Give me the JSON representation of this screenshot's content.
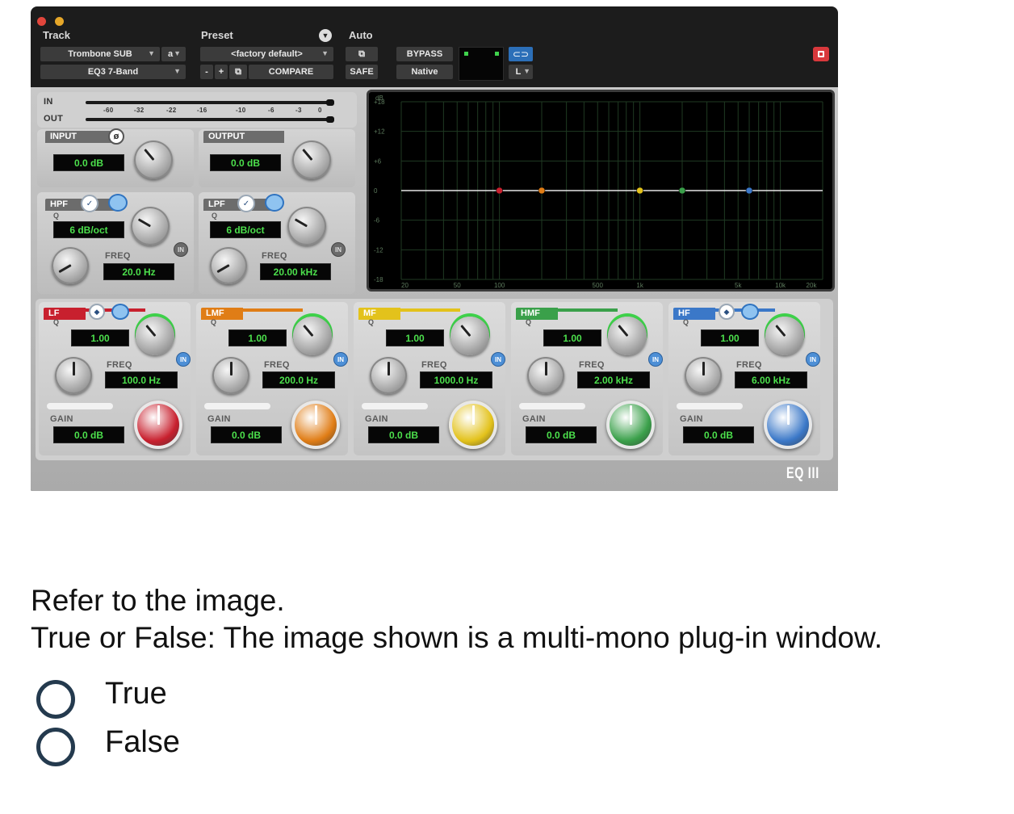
{
  "plugin": {
    "track_header": "Track",
    "preset_header": "Preset",
    "auto_header": "Auto",
    "track_name": "Trombone SUB",
    "track_slot": "a",
    "insert_name": "EQ3 7-Band",
    "preset_name": "<factory default>",
    "compare_label": "COMPARE",
    "bypass_label": "BYPASS",
    "safe_label": "SAFE",
    "native_label": "Native",
    "channel": "L",
    "meter_in": "IN",
    "meter_out": "OUT",
    "meter_ticks": [
      "-60",
      "-32",
      "-22",
      "-16",
      "-10",
      "-6",
      "-3",
      "0"
    ],
    "input": {
      "label": "INPUT",
      "value": "0.0 dB"
    },
    "output": {
      "label": "OUTPUT",
      "value": "0.0 dB"
    },
    "hpf": {
      "label": "HPF",
      "q_label": "Q",
      "slope": "6 dB/oct",
      "freq_label": "FREQ",
      "freq": "20.0 Hz",
      "in": "IN"
    },
    "lpf": {
      "label": "LPF",
      "q_label": "Q",
      "slope": "6 dB/oct",
      "freq_label": "FREQ",
      "freq": "20.00 kHz",
      "in": "IN"
    },
    "graph": {
      "db_unit": "dB",
      "db_ticks": [
        "+18",
        "+12",
        "+6",
        "0",
        "-6",
        "-12",
        "-18"
      ],
      "freq_ticks": [
        "20",
        "50",
        "100",
        "500",
        "1k",
        "5k",
        "10k",
        "20k"
      ]
    },
    "bands": [
      {
        "label": "LF",
        "q_label": "Q",
        "q": "1.00",
        "freq_label": "FREQ",
        "freq": "100.0 Hz",
        "gain_label": "GAIN",
        "gain": "0.0 dB",
        "in": "IN",
        "color": "#c8202e"
      },
      {
        "label": "LMF",
        "q_label": "Q",
        "q": "1.00",
        "freq_label": "FREQ",
        "freq": "200.0 Hz",
        "gain_label": "GAIN",
        "gain": "0.0 dB",
        "in": "IN",
        "color": "#e07d16"
      },
      {
        "label": "MF",
        "q_label": "Q",
        "q": "1.00",
        "freq_label": "FREQ",
        "freq": "1000.0 Hz",
        "gain_label": "GAIN",
        "gain": "0.0 dB",
        "in": "IN",
        "color": "#e3c21b"
      },
      {
        "label": "HMF",
        "q_label": "Q",
        "q": "1.00",
        "freq_label": "FREQ",
        "freq": "2.00 kHz",
        "gain_label": "GAIN",
        "gain": "0.0 dB",
        "in": "IN",
        "color": "#3aa04a"
      },
      {
        "label": "HF",
        "q_label": "Q",
        "q": "1.00",
        "freq_label": "FREQ",
        "freq": "6.00 kHz",
        "gain_label": "GAIN",
        "gain": "0.0 dB",
        "in": "IN",
        "color": "#3b78c8"
      }
    ],
    "logo": "EQ III"
  },
  "question": {
    "line1": "Refer to the image.",
    "line2": "True or False: The image shown is a multi-mono plug-in window.",
    "options": [
      {
        "label": "True"
      },
      {
        "label": "False"
      }
    ]
  }
}
